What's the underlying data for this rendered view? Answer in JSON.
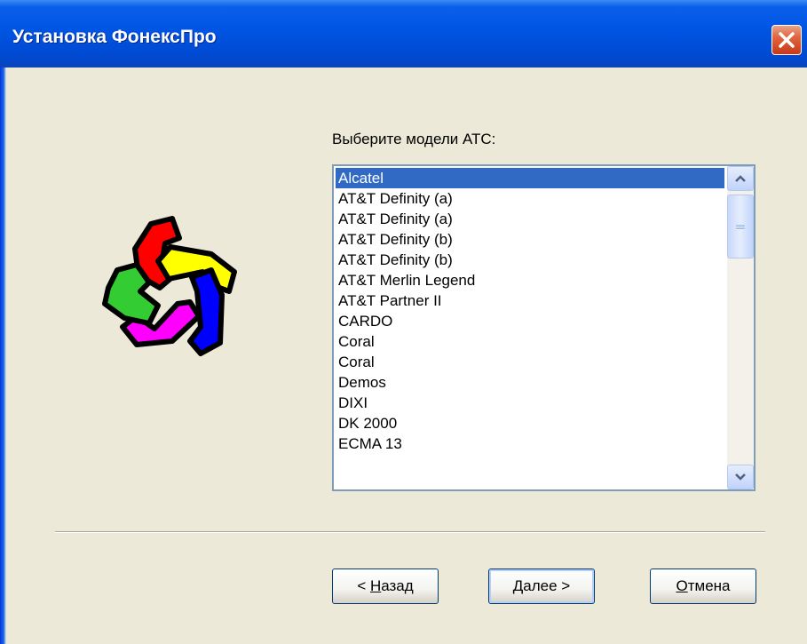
{
  "window": {
    "title": "Установка ФонексПро"
  },
  "prompt": "Выберите модели АТС:",
  "pbx_models": [
    {
      "label": "Alcatel",
      "selected": true
    },
    {
      "label": "AT&T Definity (a)",
      "selected": false
    },
    {
      "label": "AT&T Definity (a)",
      "selected": false
    },
    {
      "label": "AT&T Definity (b)",
      "selected": false
    },
    {
      "label": "AT&T Definity (b)",
      "selected": false
    },
    {
      "label": "AT&T Merlin Legend",
      "selected": false
    },
    {
      "label": "AT&T Partner II",
      "selected": false
    },
    {
      "label": "CARDO",
      "selected": false
    },
    {
      "label": "Coral",
      "selected": false
    },
    {
      "label": "Coral",
      "selected": false
    },
    {
      "label": "Demos",
      "selected": false
    },
    {
      "label": "DIXI",
      "selected": false
    },
    {
      "label": "DK 2000",
      "selected": false
    },
    {
      "label": "ECMA 13",
      "selected": false
    }
  ],
  "buttons": {
    "back": {
      "pre": "< ",
      "mnemonic": "Н",
      "rest": "азад"
    },
    "next": {
      "pre": "",
      "mnemonic": "Д",
      "rest": "алее >"
    },
    "cancel": {
      "pre": "",
      "mnemonic": "О",
      "rest": "тмена"
    }
  },
  "icons": {
    "close": "close-icon",
    "logo": "phones-logo-icon",
    "scroll_up": "chevron-up-icon",
    "scroll_down": "chevron-down-icon"
  },
  "colors": {
    "titlebar": "#0054E3",
    "selection": "#316AC5",
    "dialog_bg": "#ECE9D8",
    "logo_red": "#FF0000",
    "logo_yellow": "#FFFF00",
    "logo_blue": "#0000FF",
    "logo_magenta": "#FF00FF",
    "logo_green": "#33CC33"
  }
}
